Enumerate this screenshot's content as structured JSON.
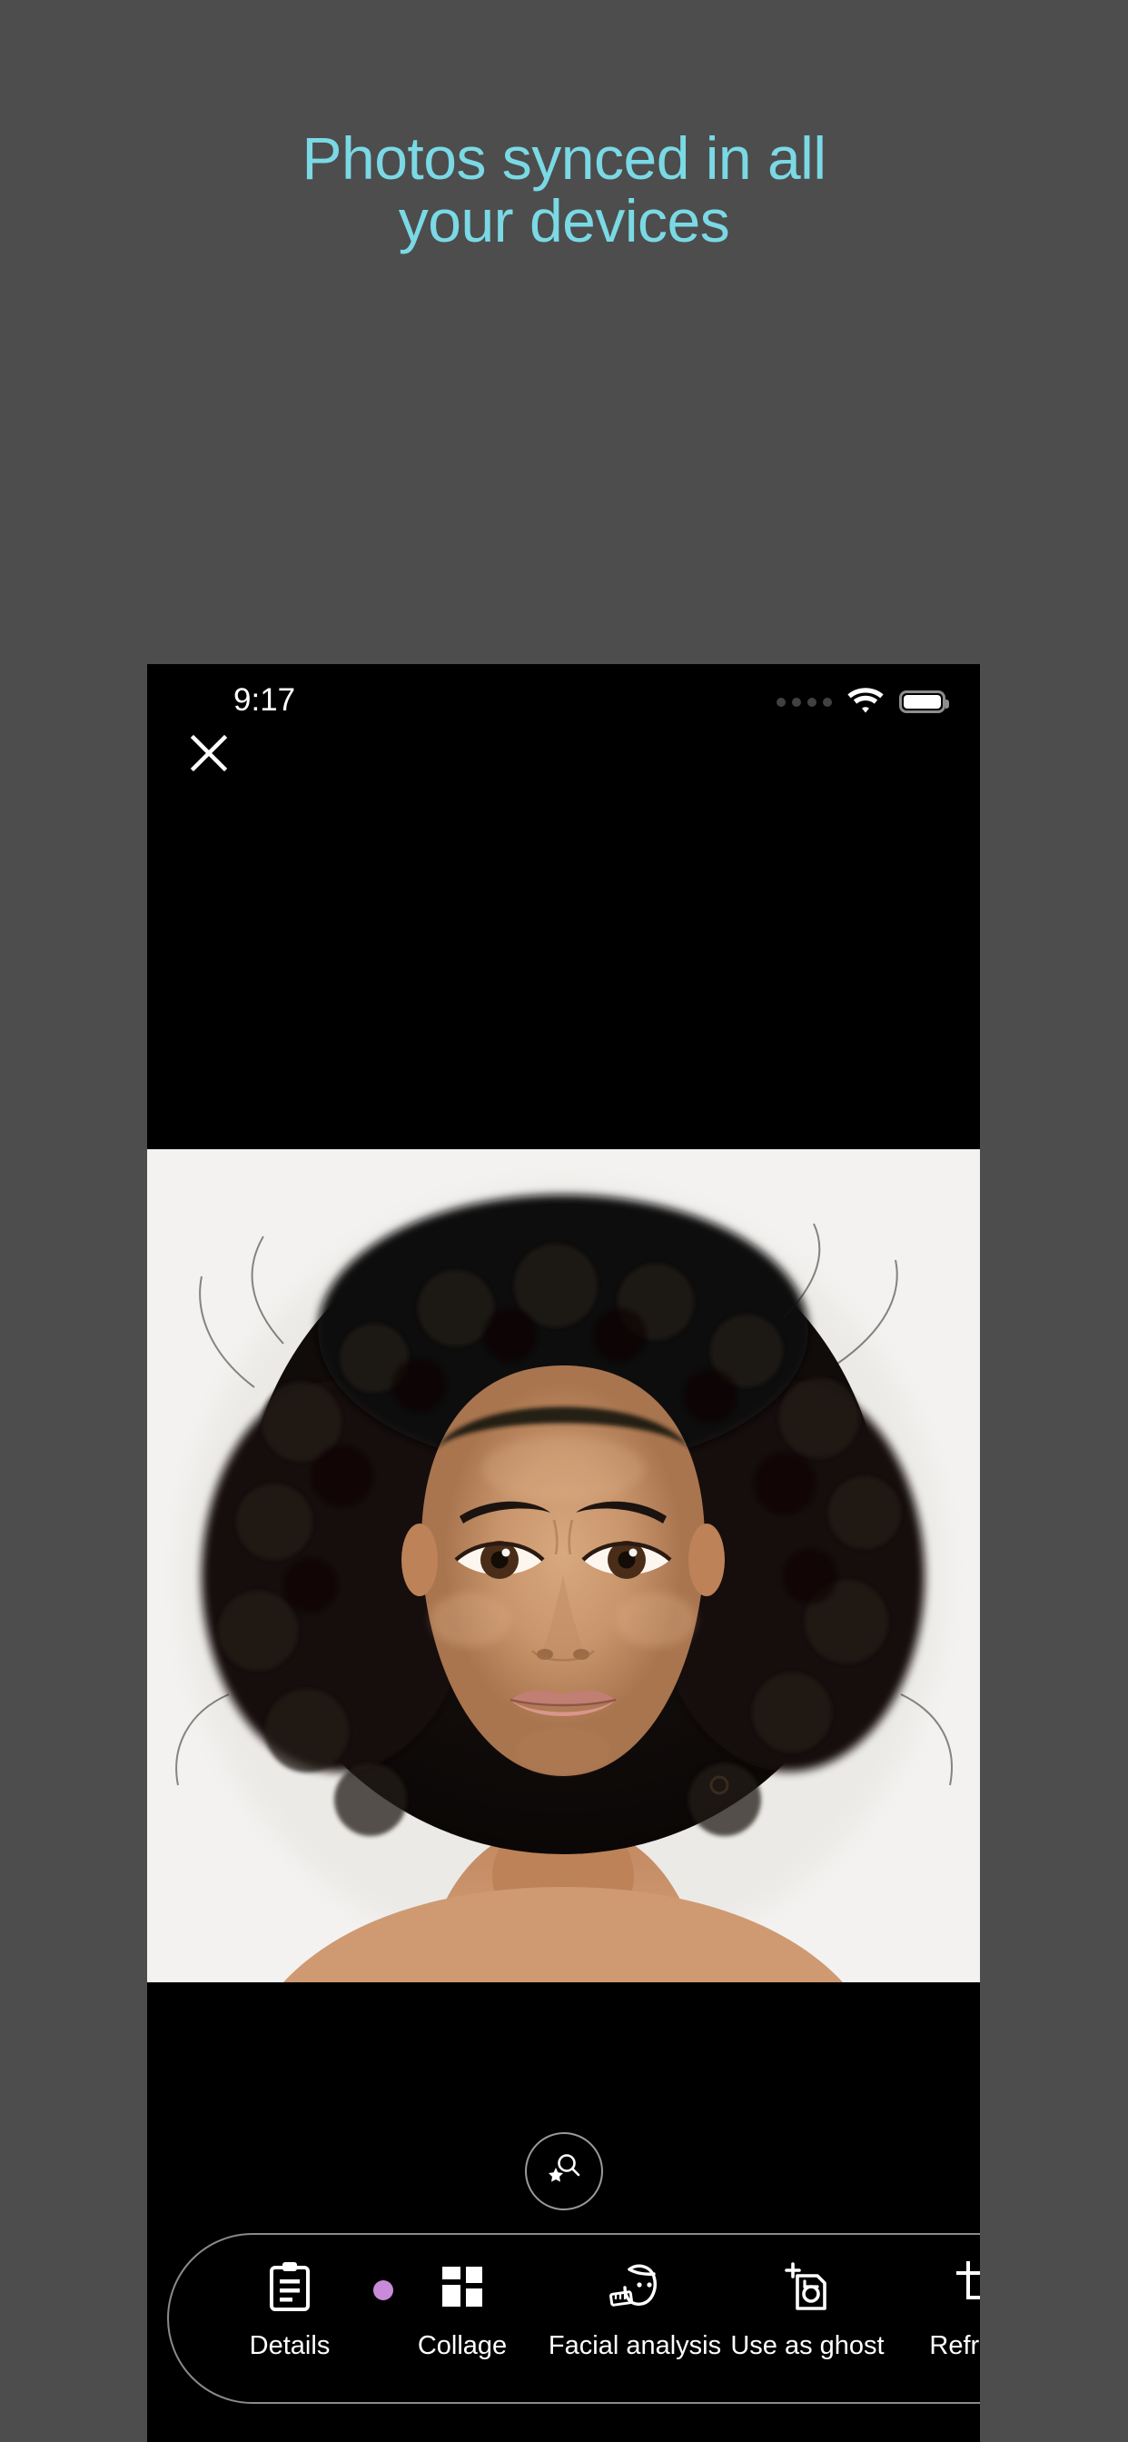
{
  "promo": {
    "heading": "Photos synced in all\nyour devices",
    "heading_color": "#7ad9e5",
    "background_color": "#4d4d4d"
  },
  "phone": {
    "status_bar": {
      "time": "9:17",
      "signal_icon": "signal-dots-icon",
      "wifi_icon": "wifi-icon",
      "battery_icon": "battery-full-icon"
    },
    "close_button": {
      "icon": "close-x-icon",
      "label": ""
    },
    "photo": {
      "alt": "portrait-photo",
      "background_color": "#f2f1ef"
    },
    "smart_search_button": {
      "icon": "magnifier-star-icon",
      "label": ""
    },
    "toolbar": {
      "items": [
        {
          "label": "Details",
          "icon": "clipboard-icon",
          "badge": true
        },
        {
          "label": "Collage",
          "icon": "grid-layout-icon",
          "badge": false
        },
        {
          "label": "Facial analysis",
          "icon": "face-measure-icon",
          "badge": false
        },
        {
          "label": "Use as ghost",
          "icon": "camera-plus-icon",
          "badge": false
        },
        {
          "label": "Reframe",
          "icon": "crop-icon",
          "badge": false
        }
      ],
      "badge_color": "#c98ada"
    }
  }
}
